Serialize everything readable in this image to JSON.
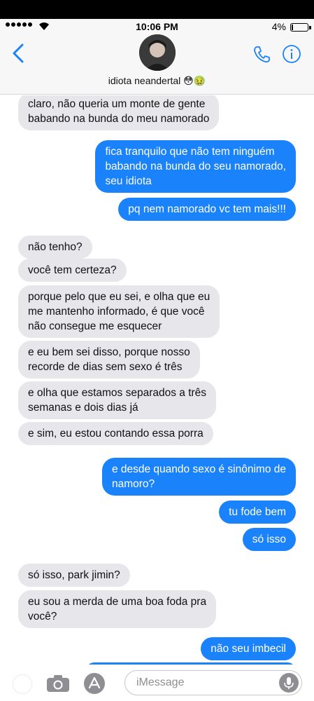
{
  "status_bar": {
    "time": "10:06 PM",
    "battery": "4%"
  },
  "header": {
    "contact_name": "idiota neandertal 😳🤢"
  },
  "messages": [
    {
      "side": "received",
      "lines": [
        "claro, não queria um monte de gente",
        "babando na bunda do meu namorado"
      ]
    },
    {
      "side": "sent",
      "lines": [
        "fica tranquilo que não tem ninguém",
        "babando na bunda do seu namorado,",
        "seu idiota"
      ]
    },
    {
      "side": "sent",
      "lines": [
        "pq nem namorado vc tem mais!!!"
      ]
    },
    {
      "side": "received",
      "lines": [
        "não tenho?"
      ]
    },
    {
      "side": "received",
      "lines": [
        "você tem certeza?"
      ]
    },
    {
      "side": "received",
      "lines": [
        "porque pelo que eu sei, e olha que eu",
        "me mantenho informado, é que você",
        "não consegue me esquecer"
      ]
    },
    {
      "side": "received",
      "lines": [
        "e eu bem sei disso, porque nosso",
        "recorde de dias sem sexo é três"
      ]
    },
    {
      "side": "received",
      "lines": [
        "e olha que estamos separados a três",
        "semanas e dois dias já"
      ]
    },
    {
      "side": "received",
      "lines": [
        "e sim, eu estou contando essa porra"
      ]
    },
    {
      "side": "sent",
      "lines": [
        "e desde quando sexo é sinônimo de",
        "namoro?"
      ]
    },
    {
      "side": "sent",
      "lines": [
        "tu fode bem"
      ]
    },
    {
      "side": "sent",
      "lines": [
        "só isso"
      ]
    },
    {
      "side": "received",
      "lines": [
        "só isso, park jimin?"
      ]
    },
    {
      "side": "received",
      "lines": [
        "eu sou a merda de uma boa foda pra",
        "você?"
      ]
    },
    {
      "side": "sent",
      "lines": [
        "não seu imbecil"
      ]
    }
  ],
  "input": {
    "placeholder": "iMessage"
  },
  "icons": {
    "back": "chevron-left-icon",
    "phone": "phone-icon",
    "info": "info-icon",
    "camera": "camera-icon",
    "apps": "app-store-icon",
    "mic": "microphone-icon"
  },
  "colors": {
    "sent": "#1a82fb",
    "received": "#e6e6eb",
    "accent": "#1a82fb"
  }
}
